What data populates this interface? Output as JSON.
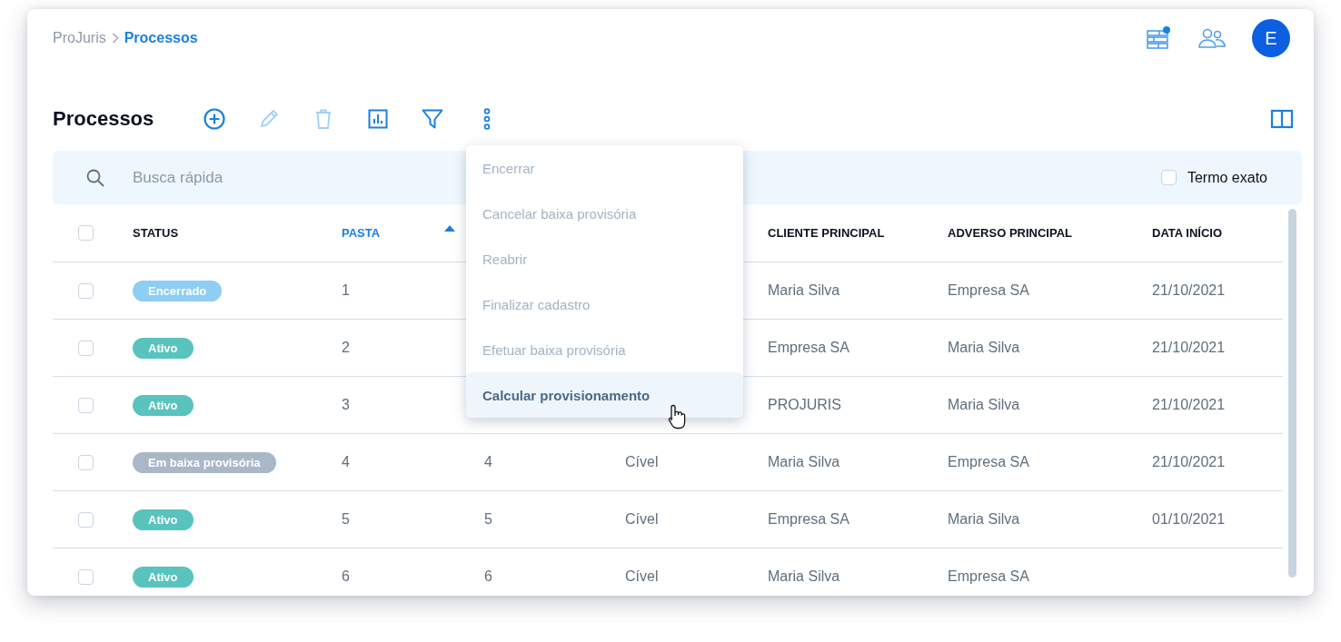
{
  "breadcrumb": [
    {
      "label": "ProJuris",
      "current": false
    },
    {
      "label": "Processos",
      "current": true
    }
  ],
  "header_icons": {
    "notification": true,
    "avatar": "E"
  },
  "title": "Processos",
  "toolbar": [
    {
      "kind": "add",
      "disabled": false
    },
    {
      "kind": "edit",
      "disabled": true
    },
    {
      "kind": "delete",
      "disabled": true
    },
    {
      "kind": "chart",
      "disabled": false
    },
    {
      "kind": "filter",
      "disabled": false
    },
    {
      "kind": "more",
      "disabled": false
    }
  ],
  "search": {
    "placeholder": "Busca rápida",
    "exact_term": {
      "label": "Termo exato",
      "checked": false
    }
  },
  "table": {
    "columns": [
      {
        "kind": "checkbox",
        "checked": false
      },
      {
        "kind": "text",
        "label": "STATUS"
      },
      {
        "kind": "text",
        "label": "PASTA",
        "sorted": true
      },
      {
        "kind": "text"
      },
      {
        "kind": "text"
      },
      {
        "kind": "text",
        "label": "CLIENTE PRINCIPAL"
      },
      {
        "kind": "text",
        "label": "ADVERSO PRINCIPAL"
      },
      {
        "kind": "text",
        "label": "DATA INÍCIO"
      }
    ],
    "rows": [
      {
        "cells": [
          {
            "kind": "checkbox",
            "checked": false
          },
          {
            "kind": "status",
            "label": "Encerrado",
            "color": "#8ecdf4"
          },
          "1",
          "",
          "",
          "Maria Silva",
          "Empresa SA",
          "21/10/2021"
        ]
      },
      {
        "cells": [
          {
            "kind": "checkbox",
            "checked": false
          },
          {
            "kind": "status",
            "label": "Ativo",
            "color": "#59c3bd"
          },
          "2",
          "",
          "",
          "Empresa SA",
          "Maria Silva",
          "21/10/2021"
        ]
      },
      {
        "cells": [
          {
            "kind": "checkbox",
            "checked": false
          },
          {
            "kind": "status",
            "label": "Ativo",
            "color": "#59c3bd"
          },
          "3",
          "",
          "",
          "PROJURIS",
          "Maria Silva",
          "21/10/2021"
        ]
      },
      {
        "cells": [
          {
            "kind": "checkbox",
            "checked": false
          },
          {
            "kind": "status",
            "label": "Em baixa provisória",
            "color": "#a9b7c7"
          },
          "4",
          "4",
          "Cível",
          "Maria Silva",
          "Empresa SA",
          "21/10/2021"
        ]
      },
      {
        "cells": [
          {
            "kind": "checkbox",
            "checked": false
          },
          {
            "kind": "status",
            "label": "Ativo",
            "color": "#59c3bd"
          },
          "5",
          "5",
          "Cível",
          "Empresa SA",
          "Maria Silva",
          "01/10/2021"
        ]
      },
      {
        "cells": [
          {
            "kind": "checkbox",
            "checked": false
          },
          {
            "kind": "status",
            "label": "Ativo",
            "color": "#59c3bd"
          },
          "6",
          "6",
          "Cível",
          "Maria Silva",
          "Empresa SA",
          ""
        ]
      }
    ]
  },
  "menu": [
    {
      "label": "Encerrar",
      "disabled": true,
      "selected": false
    },
    {
      "label": "Cancelar baixa provisória",
      "disabled": true,
      "selected": false
    },
    {
      "label": "Reabrir",
      "disabled": true,
      "selected": false
    },
    {
      "label": "Finalizar cadastro",
      "disabled": true,
      "selected": false
    },
    {
      "label": "Efetuar baixa provisória",
      "disabled": true,
      "selected": false
    },
    {
      "label": "Calcular provisionamento",
      "disabled": false,
      "selected": true
    }
  ]
}
